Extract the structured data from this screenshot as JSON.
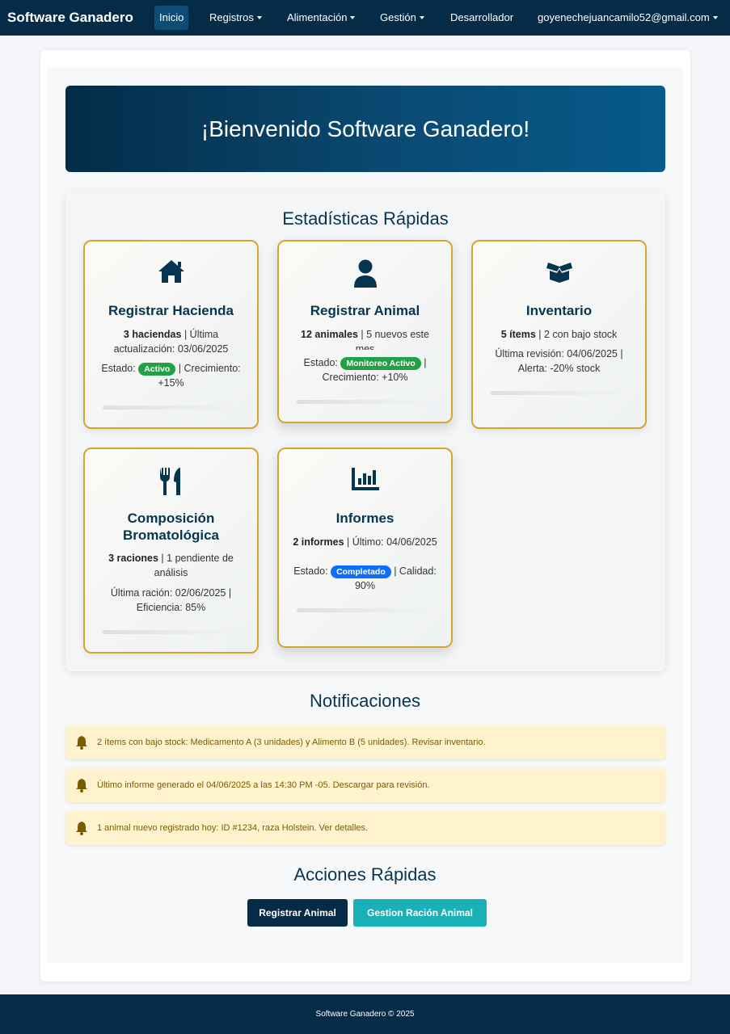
{
  "navbar": {
    "brand": "Software Ganadero",
    "items": [
      {
        "label": "Inicio"
      },
      {
        "label": "Registros"
      },
      {
        "label": "Alimentación"
      },
      {
        "label": "Gestión"
      },
      {
        "label": "Desarrollador"
      },
      {
        "label": "goyenechejuancamilo52@gmail.com"
      }
    ]
  },
  "hero": {
    "title": "¡Bienvenido Software Ganadero!"
  },
  "stats": {
    "title": "Estadísticas Rápidas",
    "cards": [
      {
        "icon": "house-icon",
        "title": "Registrar Hacienda",
        "strong": "3 haciendas",
        "line1_rest": " | Última actualización: 03/06/2025",
        "estado_label": "Estado: ",
        "badge": "Activo",
        "after_badge": " | Crecimiento: +15%"
      },
      {
        "icon": "user-icon",
        "title": "Registrar Animal",
        "strong": "12 animales",
        "line1_rest": " | 5 nuevos este mes",
        "estado_label": "Estado: ",
        "badge": "Monitoreo Activo",
        "after_badge": " | Crecimiento: +10%"
      },
      {
        "icon": "box-open-icon",
        "title": "Inventario",
        "strong": "5 ítems",
        "line1_rest": " | 2 con bajo stock",
        "line2": "Última revisión: 04/06/2025 | Alerta: -20% stock"
      },
      {
        "icon": "utensils-icon",
        "title": "Composición Bromatológica",
        "strong": "3 raciones",
        "line1_rest": " | 1 pendiente de análisis",
        "line2": "Última ración: 02/06/2025 | Eficiencia: 85%"
      },
      {
        "icon": "chart-column-icon",
        "title": "Informes",
        "strong": "2 informes",
        "line1_rest": " | Último: 04/06/2025",
        "estado_label": "Estado: ",
        "badge": "Completado",
        "after_badge": " | Calidad: 90%"
      }
    ]
  },
  "notifications": {
    "title": "Notificaciones",
    "items": [
      "2 ítems con bajo stock: Medicamento A (3 unidades) y Alimento B (5 unidades). Revisar inventario.",
      "Último informe generado el 04/06/2025 a las 14:30 PM -05. Descargar para revisión.",
      "1 animal nuevo registrado hoy: ID #1234, raza Holstein. Ver detalles."
    ]
  },
  "actions": {
    "title": "Acciones Rápidas",
    "primary": "Registrar Animal",
    "secondary": "Gestion Ración Animal"
  },
  "footer": {
    "text": "Software Ganadero © 2025"
  },
  "colors": {
    "navy": "#042c47",
    "gold": "#d4a72c",
    "teal": "#1ab0b8",
    "green": "#22a045",
    "blue": "#0d6efd",
    "alert_bg": "#fff3cd"
  }
}
